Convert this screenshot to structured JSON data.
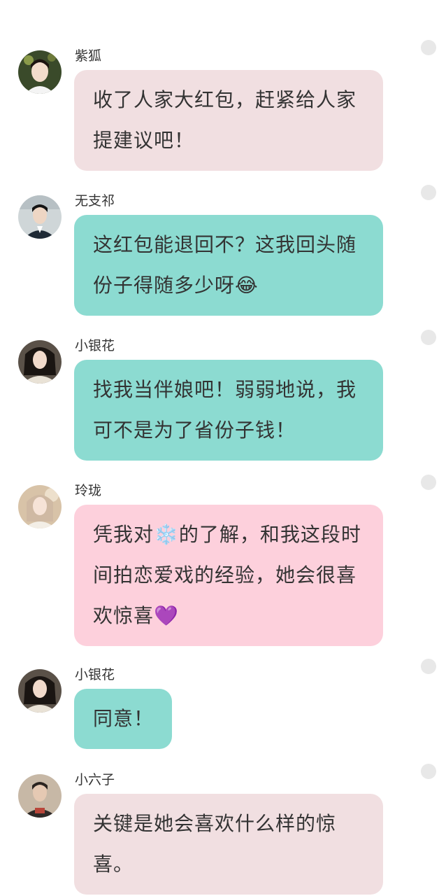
{
  "messages": [
    {
      "user": "紫狐",
      "text": "收了人家大红包，赶紧给人家提建议吧！",
      "color": "#f1dfe1"
    },
    {
      "user": "无支祁",
      "text": "这红包能退回不？这我回头随份子得随多少呀😂",
      "color": "#8cdbd1"
    },
    {
      "user": "小银花",
      "text": "找我当伴娘吧！弱弱地说，我可不是为了省份子钱！",
      "color": "#8cdbd1"
    },
    {
      "user": "玲珑",
      "text": "凭我对❄️的了解，和我这段时间拍恋爱戏的经验，她会很喜欢惊喜💜",
      "color": "#fdd0dc"
    },
    {
      "user": "小银花",
      "text": "同意！",
      "color": "#8cdbd1"
    },
    {
      "user": "小六子",
      "text": "关键是她会喜欢什么样的惊喜。",
      "color": "#f1dfe1"
    }
  ],
  "icons": {
    "avatar": "user-avatar-icon",
    "status_dot": "status-dot-icon"
  }
}
